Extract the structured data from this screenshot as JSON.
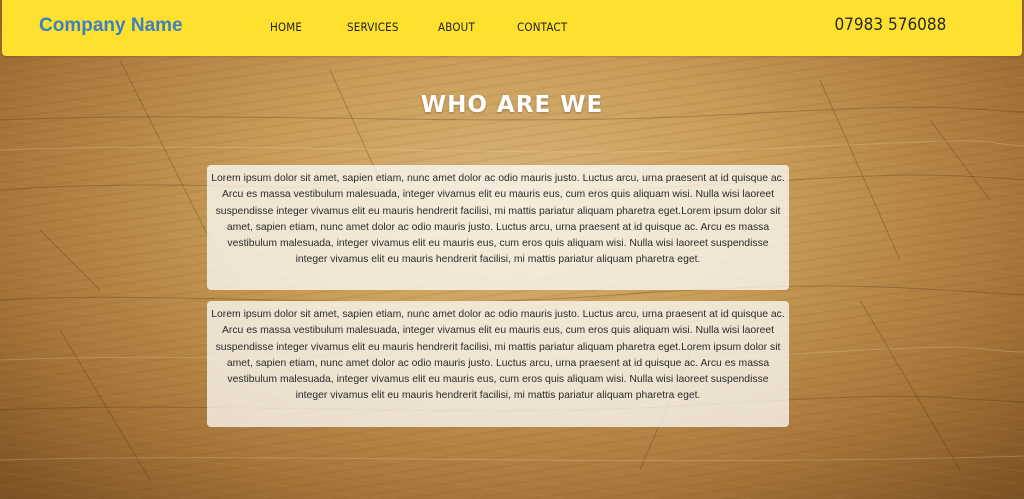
{
  "header": {
    "brand": "Company Name",
    "nav": [
      "HOME",
      "SERVICES",
      "ABOUT",
      "CONTACT"
    ],
    "phone": "07983 576088"
  },
  "main": {
    "title": "WHO ARE WE",
    "paragraphs": [
      "Lorem ipsum dolor sit amet, sapien etiam, nunc amet dolor ac odio mauris justo. Luctus arcu, urna praesent at id quisque ac. Arcu es massa vestibulum malesuada, integer vivamus elit eu mauris eus, cum eros quis aliquam wisi. Nulla wisi laoreet suspendisse integer vivamus elit eu mauris hendrerit facilisi, mi mattis pariatur aliquam pharetra eget.Lorem ipsum dolor sit amet, sapien etiam, nunc amet dolor ac odio mauris justo. Luctus arcu, urna praesent at id quisque ac. Arcu es massa vestibulum malesuada, integer vivamus elit eu mauris eus, cum eros quis aliquam wisi. Nulla wisi laoreet suspendisse integer vivamus elit eu mauris hendrerit facilisi, mi mattis pariatur aliquam pharetra eget.",
      "Lorem ipsum dolor sit amet, sapien etiam, nunc amet dolor ac odio mauris justo. Luctus arcu, urna praesent at id quisque ac. Arcu es massa vestibulum malesuada, integer vivamus elit eu mauris eus, cum eros quis aliquam wisi. Nulla wisi laoreet suspendisse integer vivamus elit eu mauris hendrerit facilisi, mi mattis pariatur aliquam pharetra eget.Lorem ipsum dolor sit amet, sapien etiam, nunc amet dolor ac odio mauris justo. Luctus arcu, urna praesent at id quisque ac. Arcu es massa vestibulum malesuada, integer vivamus elit eu mauris eus, cum eros quis aliquam wisi. Nulla wisi laoreet suspendisse integer vivamus elit eu mauris hendrerit facilisi, mi mattis pariatur aliquam pharetra eget."
    ]
  },
  "colors": {
    "header_bg": "#fee02e",
    "brand": "#3c7fc2",
    "title": "#ffffff",
    "text_box_bg": "rgba(255,255,255,0.74)"
  }
}
